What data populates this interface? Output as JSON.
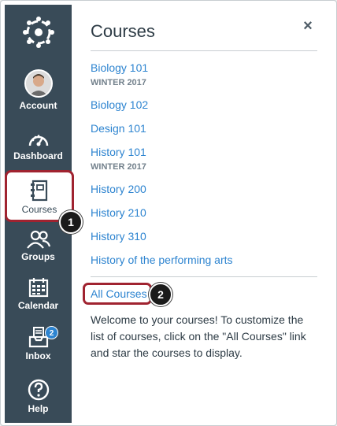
{
  "nav": {
    "account": "Account",
    "dashboard": "Dashboard",
    "courses": "Courses",
    "groups": "Groups",
    "calendar": "Calendar",
    "inbox": "Inbox",
    "inbox_badge": "2",
    "help": "Help"
  },
  "tray": {
    "title": "Courses",
    "close_icon": "×",
    "courses": [
      {
        "name": "Biology 101",
        "term": "WINTER 2017"
      },
      {
        "name": "Biology 102",
        "term": ""
      },
      {
        "name": "Design 101",
        "term": ""
      },
      {
        "name": "History 101",
        "term": "WINTER 2017"
      },
      {
        "name": "History 200",
        "term": ""
      },
      {
        "name": "History 210",
        "term": ""
      },
      {
        "name": "History 310",
        "term": ""
      },
      {
        "name": "History of the performing arts",
        "term": ""
      }
    ],
    "all_courses": "All Courses",
    "welcome": "Welcome to your courses! To customize the list of courses, click on the \"All Courses\" link and star the courses to display."
  },
  "callouts": [
    "1",
    "2"
  ],
  "colors": {
    "sidebar": "#394b58",
    "link": "#2d84d0",
    "highlight": "#a02330",
    "badge": "#2d84d0"
  }
}
